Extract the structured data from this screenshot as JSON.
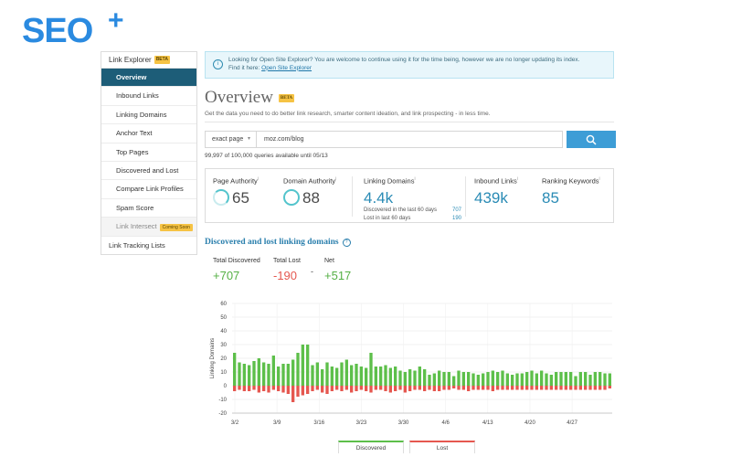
{
  "logo": {
    "text": "SEO",
    "plus": "+"
  },
  "sidebar": {
    "header": "Link Explorer",
    "header_badge": "BETA",
    "items": [
      {
        "label": "Overview"
      },
      {
        "label": "Inbound Links"
      },
      {
        "label": "Linking Domains"
      },
      {
        "label": "Anchor Text"
      },
      {
        "label": "Top Pages"
      },
      {
        "label": "Discovered and Lost"
      },
      {
        "label": "Compare Link Profiles"
      },
      {
        "label": "Spam Score"
      },
      {
        "label": "Link Intersect"
      },
      {
        "label": "Link Tracking Lists"
      }
    ],
    "coming_soon": "Coming Soon"
  },
  "notice": {
    "line1": "Looking for Open Site Explorer? You are welcome to continue using it for the time being, however we are no longer updating its index.",
    "line2_prefix": "Find it here:",
    "link": "Open Site Explorer"
  },
  "page": {
    "title": "Overview",
    "title_badge": "BETA",
    "subtitle": "Get the data you need to do better link research, smarter content ideation, and link prospecting - in less time."
  },
  "search": {
    "mode": "exact page",
    "query": "moz.com/blog",
    "quota": "99,997 of 100,000 queries available until 05/13"
  },
  "metrics": {
    "page_authority": {
      "label": "Page Authority",
      "value": "65"
    },
    "domain_authority": {
      "label": "Domain Authority",
      "value": "88"
    },
    "linking_domains": {
      "label": "Linking Domains",
      "value": "4.4k",
      "discovered_label": "Discovered in the last 60 days",
      "discovered_value": "707",
      "lost_label": "Lost in last 60 days",
      "lost_value": "190"
    },
    "inbound_links": {
      "label": "Inbound Links",
      "value": "439k"
    },
    "ranking_keywords": {
      "label": "Ranking Keywords",
      "value": "85"
    },
    "sup": "i"
  },
  "discovered": {
    "heading": "Discovered and lost linking domains",
    "total_discovered_label": "Total Discovered",
    "total_discovered": "+707",
    "total_lost_label": "Total Lost",
    "total_lost": "-190",
    "net_label": "Net",
    "net": "+517",
    "dash": "-"
  },
  "colors": {
    "discovered": "#5dbf4a",
    "lost": "#e5574f",
    "accent": "#2a8bb5",
    "active_nav": "#1d5d78"
  },
  "chart_data": {
    "type": "bar",
    "ylabel": "Linking Domains",
    "ylim": [
      -20,
      60
    ],
    "yticks": [
      "60",
      "50",
      "40",
      "30",
      "20",
      "10",
      "0",
      "-10",
      "-20"
    ],
    "x_tick_labels": [
      "3/2",
      "3/9",
      "3/16",
      "3/23",
      "3/30",
      "4/6",
      "4/13",
      "4/20",
      "4/27"
    ],
    "series": [
      {
        "name": "Discovered",
        "values": [
          24,
          17,
          16,
          15,
          18,
          20,
          17,
          16,
          22,
          14,
          16,
          16,
          19,
          24,
          30,
          30,
          15,
          17,
          12,
          17,
          14,
          13,
          17,
          19,
          15,
          16,
          14,
          13,
          24,
          14,
          14,
          15,
          13,
          14,
          11,
          10,
          12,
          11,
          14,
          12,
          8,
          9,
          11,
          10,
          10,
          7,
          11,
          10,
          10,
          9,
          8,
          9,
          10,
          11,
          10,
          11,
          9,
          8,
          9,
          9,
          10,
          11,
          9,
          11,
          9,
          8,
          10,
          10,
          10,
          10,
          7,
          10,
          10,
          8,
          10,
          10,
          9,
          9
        ]
      },
      {
        "name": "Lost",
        "values": [
          -4,
          -3,
          -4,
          -4,
          -3,
          -5,
          -4,
          -5,
          -3,
          -4,
          -5,
          -6,
          -12,
          -8,
          -7,
          -6,
          -4,
          -3,
          -5,
          -6,
          -4,
          -3,
          -4,
          -3,
          -5,
          -4,
          -3,
          -4,
          -5,
          -3,
          -3,
          -4,
          -5,
          -4,
          -3,
          -5,
          -4,
          -3,
          -3,
          -4,
          -3,
          -4,
          -4,
          -3,
          -3,
          -2,
          -3,
          -3,
          -4,
          -3,
          -3,
          -3,
          -3,
          -4,
          -3,
          -3,
          -3,
          -3,
          -3,
          -3,
          -3,
          -3,
          -3,
          -3,
          -3,
          -3,
          -3,
          -3,
          -3,
          -3,
          -3,
          -3,
          -3,
          -3,
          -3,
          -3,
          -3,
          -2
        ]
      }
    ],
    "legend_position": "bottom",
    "grid": true
  }
}
